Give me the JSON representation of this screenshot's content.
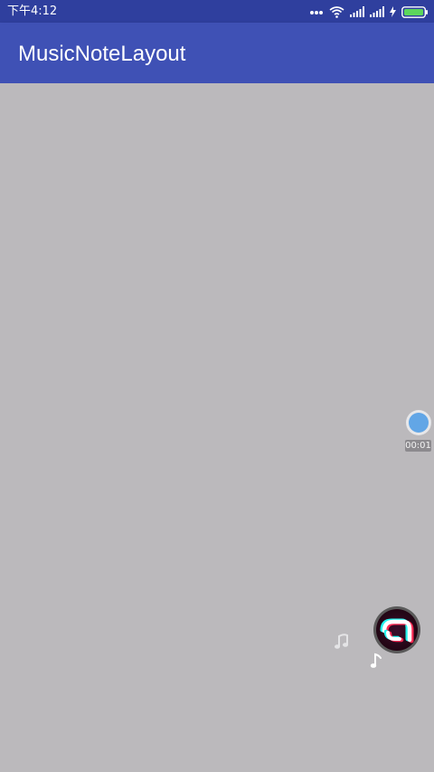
{
  "status_bar": {
    "time": "下午4:12",
    "background_color": "#2f3f9e",
    "icons": [
      "more-dots-icon",
      "wifi-icon",
      "signal-icon",
      "signal-icon",
      "charging-icon",
      "battery-icon"
    ]
  },
  "app_bar": {
    "title": "MusicNoteLayout",
    "background_color": "#3f51b5"
  },
  "content": {
    "background_color": "#bbb9bc"
  },
  "recorder": {
    "button_icon": "record-dot-icon",
    "timer": "00:01",
    "accent_color": "#62a6e6"
  },
  "music_disc": {
    "icon": "tiktok-logo-icon"
  },
  "notes": [
    "music-note-icon",
    "music-note-icon"
  ]
}
